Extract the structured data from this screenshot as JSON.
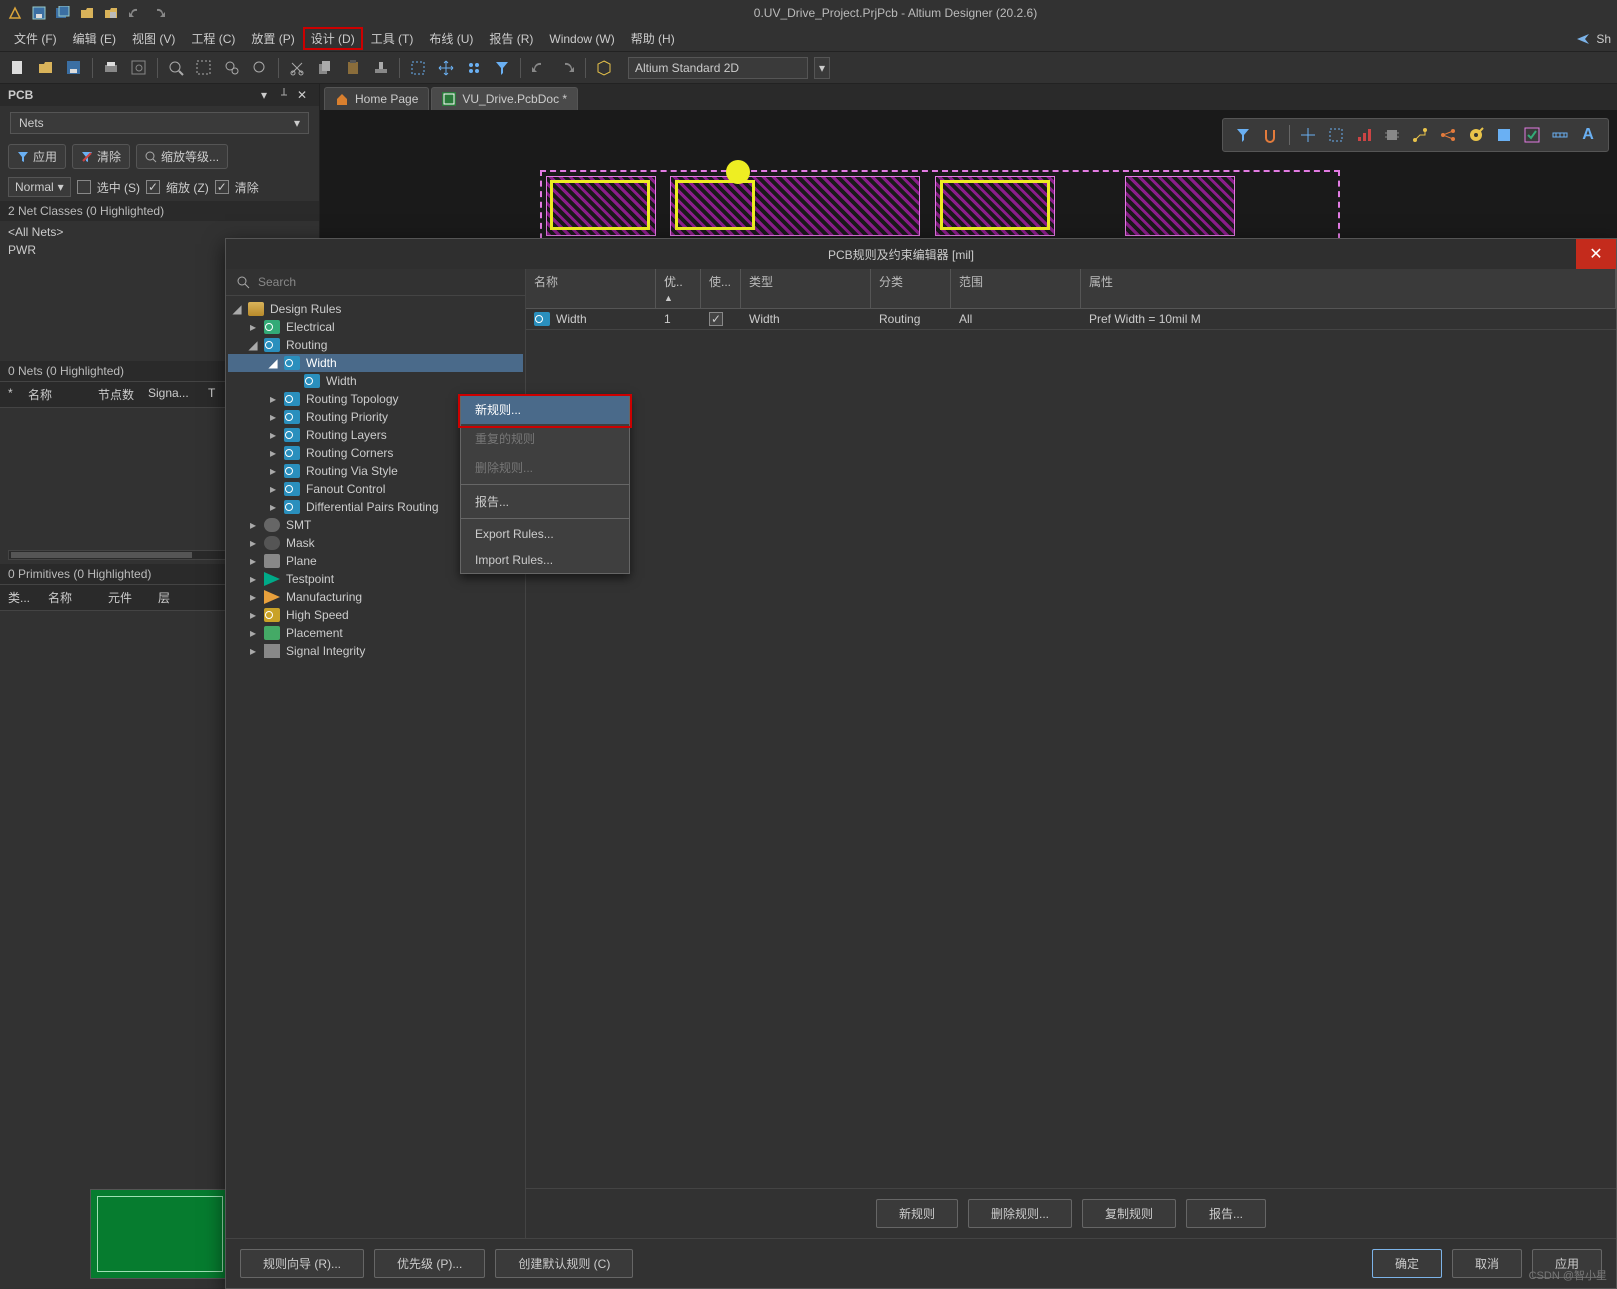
{
  "app": {
    "title": "0.UV_Drive_Project.PrjPcb - Altium Designer (20.2.6)"
  },
  "menu": {
    "file": "文件 (F)",
    "edit": "编辑 (E)",
    "view": "视图 (V)",
    "project": "工程 (C)",
    "place": "放置 (P)",
    "design": "设计 (D)",
    "tools": "工具 (T)",
    "route": "布线 (U)",
    "report": "报告 (R)",
    "window": "Window (W)",
    "help": "帮助 (H)",
    "share": "Sh"
  },
  "toolbar": {
    "viewmode": "Altium Standard 2D"
  },
  "tabs": {
    "home": "Home Page",
    "doc": "VU_Drive.PcbDoc *"
  },
  "pcb": {
    "title": "PCB",
    "selector": "Nets",
    "apply": "应用",
    "clear": "清除",
    "zoomlvl": "缩放等级...",
    "normal": "Normal",
    "sel": "选中 (S)",
    "zoom": "缩放 (Z)",
    "clear2": "清除",
    "netclasses_hdr": "2 Net Classes (0 Highlighted)",
    "allnets": "<All Nets>",
    "pwr": "PWR",
    "nets_hdr": "0 Nets (0 Highlighted)",
    "gridcols": {
      "star": "*",
      "name": "名称",
      "nodes": "节点数",
      "signal": "Signa...",
      "t": "T"
    },
    "prims_hdr": "0 Primitives (0 Highlighted)",
    "primcols": {
      "type": "类...",
      "name": "名称",
      "comp": "元件",
      "layer": "层"
    }
  },
  "dialog": {
    "title": "PCB规则及约束编辑器 [mil]",
    "search": "Search",
    "tree": {
      "root": "Design Rules",
      "electrical": "Electrical",
      "routing": "Routing",
      "width": "Width",
      "width_rule": "Width",
      "rtopology": "Routing Topology",
      "rpriority": "Routing Priority",
      "rlayers": "Routing Layers",
      "rcorners": "Routing Corners",
      "rvia": "Routing Via Style",
      "fanout": "Fanout Control",
      "diffpairs": "Differential Pairs Routing",
      "smt": "SMT",
      "mask": "Mask",
      "plane": "Plane",
      "testpoint": "Testpoint",
      "manufacturing": "Manufacturing",
      "highspeed": "High Speed",
      "placement": "Placement",
      "signalint": "Signal Integrity"
    },
    "grid": {
      "cols": {
        "name": "名称",
        "pri": "优..",
        "en": "使...",
        "type": "类型",
        "cat": "分类",
        "scope": "范围",
        "attr": "属性"
      },
      "row": {
        "name": "Width",
        "pri": "1",
        "type": "Width",
        "cat": "Routing",
        "scope": "All",
        "attr": "Pref Width = 10mil   M"
      }
    },
    "btns": {
      "new": "新规则",
      "del": "删除规则...",
      "copy": "复制规则",
      "report": "报告..."
    },
    "foot": {
      "wizard": "规则向导 (R)...",
      "priority": "优先级 (P)...",
      "defaults": "创建默认规则 (C)",
      "ok": "确定",
      "cancel": "取消",
      "apply": "应用"
    }
  },
  "ctx": {
    "new": "新规则...",
    "dup": "重复的规则",
    "del": "删除规则...",
    "report": "报告...",
    "export": "Export Rules...",
    "import": "Import Rules..."
  },
  "watermark": "CSDN @智小星"
}
